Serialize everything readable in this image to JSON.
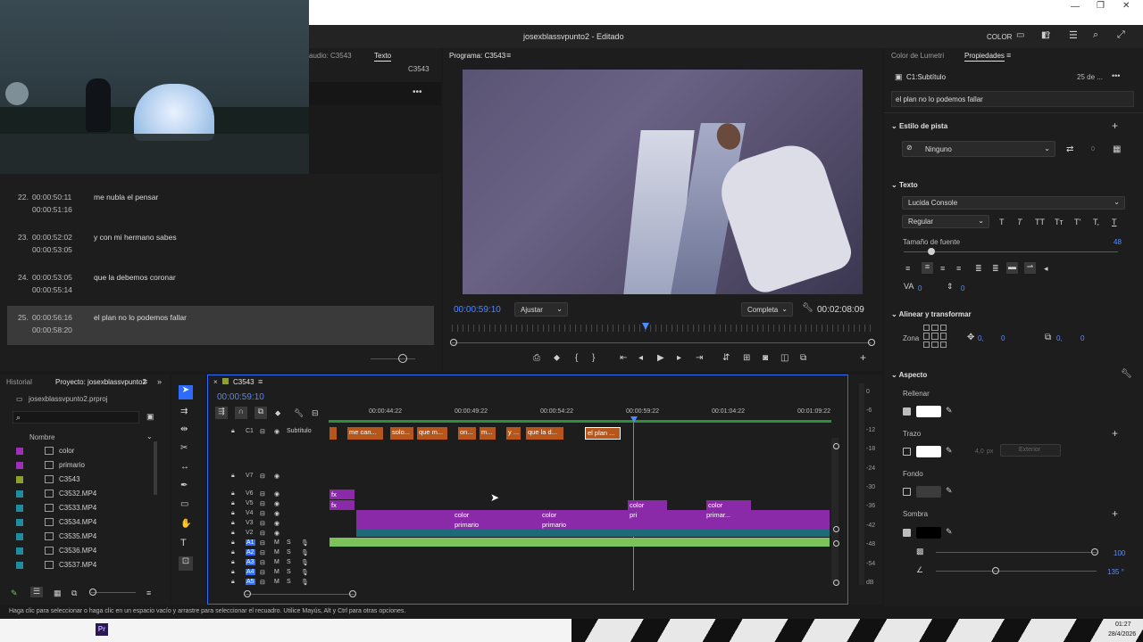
{
  "window": {
    "title": "josexblassvpunto2 - Editado",
    "color_label": "COLOR"
  },
  "subtitle_panel": {
    "tab_audio": "audio: C3543",
    "tab_text": "Texto",
    "seq": "C3543",
    "rows": [
      {
        "num": "22.",
        "in": "00:00:50:11",
        "out": "00:00:51:16",
        "text": "me nubla el pensar"
      },
      {
        "num": "23.",
        "in": "00:00:52:02",
        "out": "00:00:53:05",
        "text": "y con mi hermano sabes"
      },
      {
        "num": "24.",
        "in": "00:00:53:05",
        "out": "00:00:55:14",
        "text": "que la debemos coronar"
      },
      {
        "num": "25.",
        "in": "00:00:56:16",
        "out": "00:00:58:20",
        "text": "el plan no lo podemos fallar"
      }
    ]
  },
  "program": {
    "tab": "Programa: C3543",
    "timecode": "00:00:59:10",
    "fit": "Ajustar",
    "quality": "Completa",
    "duration": "00:02:08:09"
  },
  "props": {
    "tab_lumetri": "Color de Lumetri",
    "tab_props": "Propiedades",
    "item": "C1:Subtítulo",
    "date": "25 de ...",
    "text_value": "el plan no lo podemos fallar",
    "style_section": "Estilo de pista",
    "style_value": "Ninguno",
    "style_count": "0",
    "text_section": "Texto",
    "font": "Lucida Console",
    "weight": "Regular",
    "size_label": "Tamaño de fuente",
    "size_value": "48",
    "tracking": "0",
    "leading": "0",
    "align_section": "Alinear y transformar",
    "zone": "Zona",
    "pos_x": "0,",
    "pos_y": "0",
    "scale_x": "0,",
    "scale_y": "0",
    "aspect_section": "Aspecto",
    "fill": "Rellenar",
    "stroke": "Trazo",
    "stroke_w": "4,0",
    "stroke_unit": "px",
    "stroke_type": "Exterior",
    "bg": "Fondo",
    "shadow": "Sombra",
    "shadow_opacity": "100",
    "shadow_angle": "135 °"
  },
  "project": {
    "tab_history": "Historial",
    "tab_project": "Proyecto: josexblassvpunto2",
    "file": "josexblassvpunto2.prproj",
    "col_name": "Nombre",
    "items": [
      {
        "name": "color",
        "color": "#a02fb8"
      },
      {
        "name": "primario",
        "color": "#a02fb8"
      },
      {
        "name": "C3543",
        "color": "#8ea12c"
      },
      {
        "name": "C3532.MP4",
        "color": "#1d8ea0"
      },
      {
        "name": "C3533.MP4",
        "color": "#1d8ea0"
      },
      {
        "name": "C3534.MP4",
        "color": "#1d8ea0"
      },
      {
        "name": "C3535.MP4",
        "color": "#1d8ea0"
      },
      {
        "name": "C3536.MP4",
        "color": "#1d8ea0"
      },
      {
        "name": "C3537.MP4",
        "color": "#1d8ea0"
      }
    ]
  },
  "timeline": {
    "seq": "C3543",
    "timecode": "00:00:59:10",
    "ruler": [
      "00:00:44:22",
      "00:00:49:22",
      "00:00:54:22",
      "00:00:59:22",
      "00:01:04:22",
      "00:01:09:22"
    ],
    "sub_track": "Subtítulo",
    "sub_clips": [
      "me can...",
      "solo...",
      "que m...",
      "on...",
      "m...",
      "y ...",
      "que la d...",
      "el plan ..."
    ],
    "tracks": [
      "C1",
      "V7",
      "V6",
      "V5",
      "V4",
      "V3",
      "V2",
      "A1",
      "A2",
      "A3",
      "A4",
      "A5"
    ],
    "clip_labels": {
      "color": "color",
      "primario": "primario",
      "pri": "pri",
      "primar": "primar..."
    }
  },
  "meter": {
    "db": [
      "0",
      "-6",
      "-12",
      "-18",
      "-24",
      "-30",
      "-36",
      "-42",
      "-48",
      "-54",
      "dB"
    ]
  },
  "status": "Haga clic para seleccionar o haga clic en un espacio vacío y arrastre para seleccionar el recuadro. Utilice Mayús, Alt y Ctrl para otras opciones.",
  "taskbar": {
    "time": "01:27",
    "date": "28/4/2026",
    "app": "Pr"
  }
}
